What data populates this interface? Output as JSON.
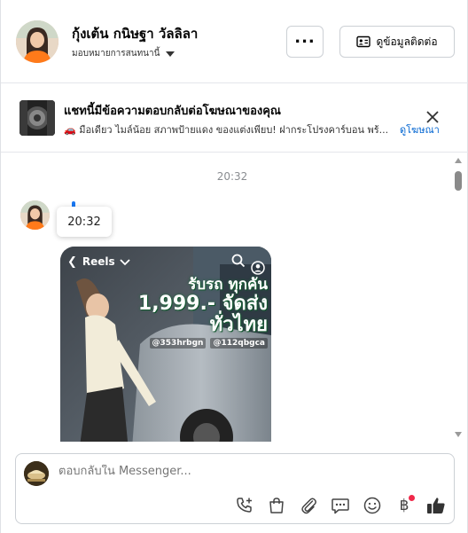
{
  "header": {
    "contact_name": "กุ้งเต้น กนิษฐา วัลลิลา",
    "assign_label": "มอบหมายการสนทนานี้",
    "more_label": "...",
    "contact_info_label": "ดูข้อมูลติดต่อ"
  },
  "ad_banner": {
    "title": "แชทนี้มีข้อความตอบกลับต่อโฆษณาของคุณ",
    "subtitle": "🚗 มือเดียว ไมล์น้อย สภาพป้ายแดง ของแต่งเพียบ! ฝากระโปรงคาร์บอน พร้...",
    "link_label": "ดูโฆษณา"
  },
  "conversation": {
    "timestamp": "20:32",
    "tooltip_time": "20:32",
    "reel": {
      "label": "Reels",
      "promo_line1": "รับรถ ทุกคัน",
      "promo_line2": "1,999.- จัดส่งทั่วไทย",
      "tag1": "@353hrbgn",
      "tag2": "@112qbgca"
    }
  },
  "composer": {
    "placeholder": "ตอบกลับใน Messenger..."
  },
  "colors": {
    "accent_blue": "#1877f2",
    "link_blue": "#0064d1",
    "badge_red": "#f02849"
  }
}
